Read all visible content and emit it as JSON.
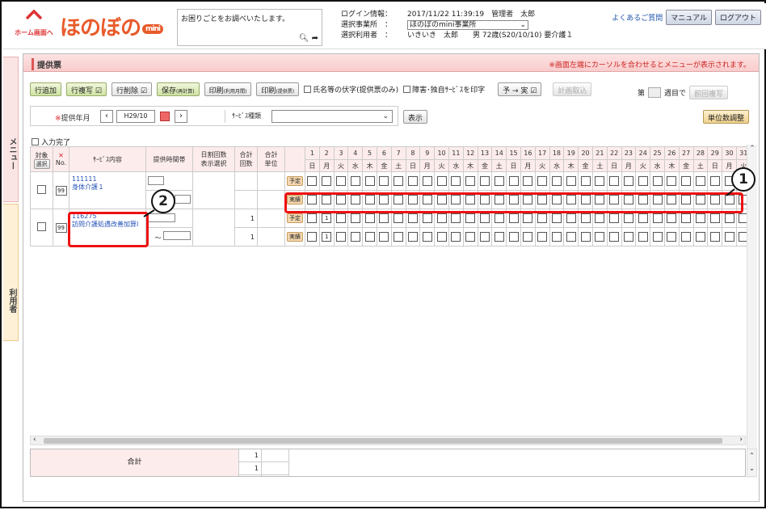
{
  "header": {
    "home_label": "ホーム画面へ",
    "logo_text": "ほのぼの",
    "logo_badge": "mini",
    "help_text": "お困りごとをお調べいたします。",
    "login_label": "ログイン情報：",
    "login_value": "2017/11/22 11:39:19　管理者　太郎",
    "office_label": "選択事業所　：",
    "office_value": "ほのぼのmini事業所",
    "user_label": "選択利用者　：",
    "user_value": "いきいき　太郎　　男 72歳(S20/10/10) 要介護１",
    "faq_link": "よくあるご質問",
    "manual_button": "マニュアル",
    "logout_button": "ログアウト"
  },
  "side": {
    "menu_tab": "メニュー",
    "user_tab": "利用者"
  },
  "panel": {
    "title": "提供票",
    "note": "※画面左端にカーソルを合わせるとメニューが表示されます。"
  },
  "toolbar": {
    "add_row": "行追加",
    "copy_row": "行複写",
    "delete_row": "行削除",
    "save": "保存",
    "save_sub": "(再計算)",
    "print1": "印刷",
    "print1_sub": "(利用月間)",
    "print2": "印刷",
    "print2_sub": "(提供票)",
    "chk_name": "氏名等の伏字(提供票のみ)",
    "chk_dis": "障害･独自ｻｰﾋﾞｽを印字",
    "plan_to_actual": "予 → 実",
    "plan_import": "計画取込",
    "week_prefix": "第",
    "week_suffix": "週目で",
    "prev_copy": "前回複写",
    "unit_adjust": "単位数調整",
    "show": "表示"
  },
  "filter": {
    "ym_label": "提供年月",
    "ym_value": "H29/10",
    "svc_label": "ｻｰﾋﾞｽ種類",
    "svc_value": ""
  },
  "input_done": "入力完了",
  "grid": {
    "headers": {
      "target": "対象",
      "select": "選択",
      "no": "No.",
      "svc": "ｻｰﾋﾞｽ内容",
      "time": "提供時間帯",
      "daily_line1": "日割回数",
      "daily_line2": "表示選択",
      "sum_count_line1": "合計",
      "sum_count_line2": "回数",
      "sum_unit_line1": "合計",
      "sum_unit_line2": "単位"
    },
    "days": [
      "1",
      "2",
      "3",
      "4",
      "5",
      "6",
      "7",
      "8",
      "9",
      "10",
      "11",
      "12",
      "13",
      "14",
      "15",
      "16",
      "17",
      "18",
      "19",
      "20",
      "21",
      "22",
      "23",
      "24",
      "25",
      "26",
      "27",
      "28",
      "29",
      "30",
      "31"
    ],
    "weekdays": [
      "日",
      "月",
      "火",
      "水",
      "木",
      "金",
      "土",
      "日",
      "月",
      "火",
      "水",
      "木",
      "金",
      "土",
      "日",
      "月",
      "火",
      "水",
      "木",
      "金",
      "土",
      "日",
      "月",
      "火",
      "水",
      "木",
      "金",
      "土",
      "日",
      "月",
      "火"
    ],
    "plan_label": "予定",
    "actual_label": "実績",
    "rows": [
      {
        "no": "99",
        "code": "111111",
        "name": "身体介護１",
        "sum_count": "",
        "plan_cells": "",
        "actual_cells": ""
      },
      {
        "no": "99",
        "code": "116275",
        "name": "訪問介護処遇改善加算Ⅰ",
        "sum_count_plan": "1",
        "sum_count_actual": "1",
        "day2_plan": "1",
        "day2_actual": "1",
        "time_tilde": "～"
      }
    ]
  },
  "totals": {
    "label": "合計",
    "count1": "1",
    "count2": "1"
  },
  "callouts": {
    "one": "1",
    "two": "2"
  }
}
